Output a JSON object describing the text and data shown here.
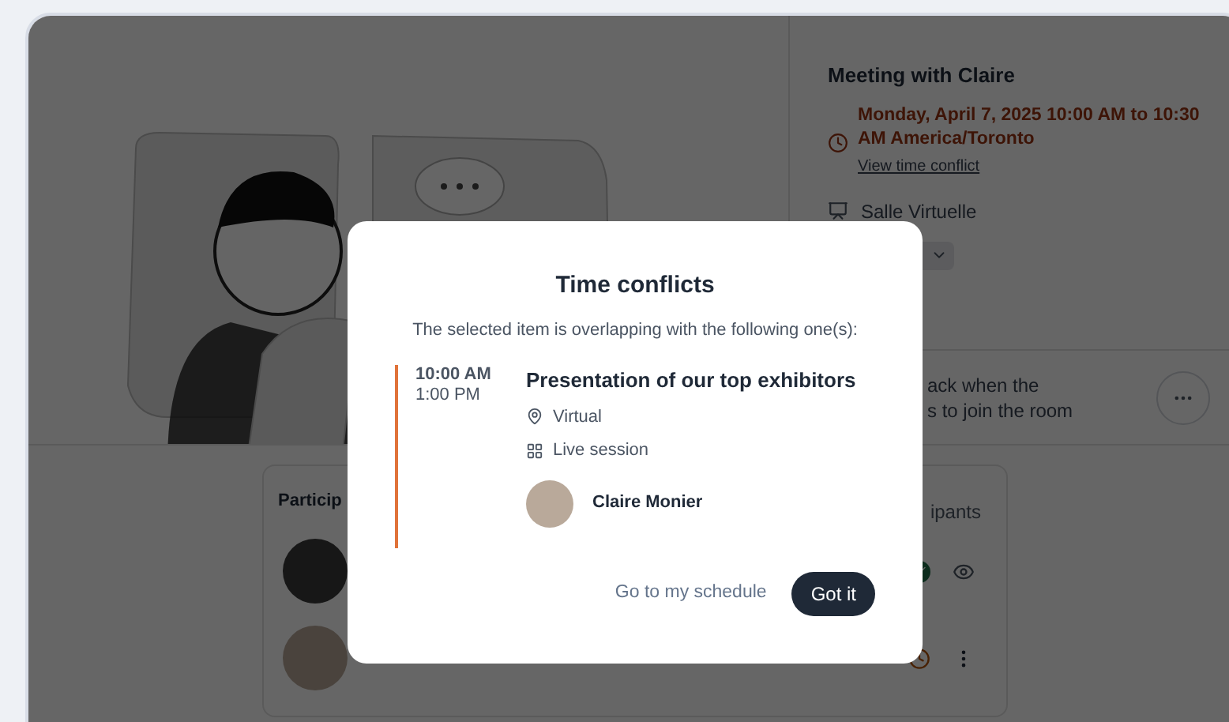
{
  "meeting": {
    "title": "Meeting with Claire",
    "datetime": "Monday, April 7, 2025 10:00 AM to 10:30 AM America/Toronto",
    "conflict_link": "View time conflict",
    "room": "Salle Virtuelle"
  },
  "notice": {
    "line_1": "ack when the",
    "line_2": "s to join the room"
  },
  "participants": {
    "title": "Particip",
    "column_2": "ipants",
    "rows": [
      {
        "kind": "confirmed"
      },
      {
        "kind": "pending"
      }
    ]
  },
  "dialog": {
    "title": "Time conflicts",
    "subtitle": "The selected item is overlapping with the following one(s):",
    "conflicts": [
      {
        "start": "10:00 AM",
        "end": "1:00 PM",
        "title": "Presentation of our top exhibitors",
        "location": "Virtual",
        "format": "Live session",
        "speaker": "Claire Monier",
        "color": "#e0733a"
      }
    ],
    "buttons": [
      {
        "label": "Go to my schedule",
        "kind": "link"
      },
      {
        "label": "Got it",
        "kind": "primary"
      }
    ]
  }
}
